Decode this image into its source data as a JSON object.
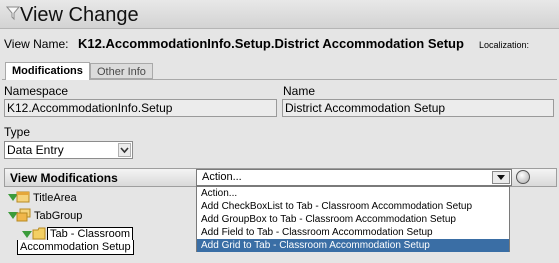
{
  "window": {
    "title": "View Change"
  },
  "view_name": {
    "label": "View Name:",
    "value": "K12.AccommodationInfo.Setup.District Accommodation Setup"
  },
  "localization": {
    "label": "Localization:"
  },
  "tabs": [
    {
      "label": "Modifications",
      "active": true
    },
    {
      "label": "Other Info",
      "active": false
    }
  ],
  "namespace": {
    "label": "Namespace",
    "value": "K12.AccommodationInfo.Setup"
  },
  "name": {
    "label": "Name",
    "value": "District Accommodation Setup"
  },
  "type": {
    "label": "Type",
    "value": "Data Entry"
  },
  "view_modifications": {
    "title": "View Modifications",
    "action_value": "Action...",
    "options": [
      "Action...",
      "Add CheckBoxList to Tab - Classroom Accommodation Setup",
      "Add GroupBox to Tab - Classroom Accommodation Setup",
      "Add Field to Tab - Classroom Accommodation Setup",
      "Add Grid to Tab - Classroom Accommodation Setup"
    ],
    "selected_index": 4
  },
  "tree": {
    "items": [
      {
        "label": "TitleArea"
      },
      {
        "label": "TabGroup"
      },
      {
        "label": "Tab - Classroom"
      },
      {
        "label": "Accommodation Setup"
      }
    ]
  },
  "colors": {
    "selection": "#3a6ea5",
    "tree_arrow": "#3b9b3b"
  },
  "icons": [
    "filter-icon",
    "tree-expand-icon",
    "folder-icon",
    "go-icon",
    "dropdown-arrow-icon"
  ]
}
